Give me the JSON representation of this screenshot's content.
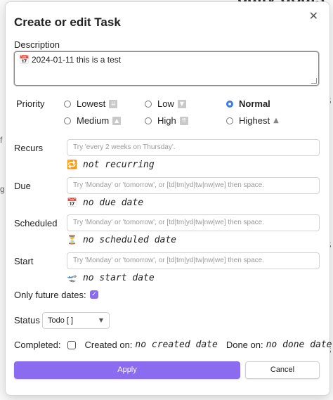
{
  "background": {
    "heading": "daily goals",
    "right_glyphs": [
      "S",
      "o",
      "S",
      "u",
      "s",
      "S"
    ],
    "left_glyphs": [
      "f",
      "g"
    ]
  },
  "modal": {
    "title": "Create or edit Task",
    "close_icon": "close-icon"
  },
  "description": {
    "label": "Description",
    "value": "2024-01-11 this is a test",
    "icon": "calendar-icon"
  },
  "priority": {
    "label": "Priority",
    "options": [
      {
        "label": "Lowest",
        "icon": "double-down-icon",
        "selected": false
      },
      {
        "label": "Low",
        "icon": "down-icon",
        "selected": false
      },
      {
        "label": "Normal",
        "icon": "",
        "selected": true
      },
      {
        "label": "Medium",
        "icon": "up-icon",
        "selected": false
      },
      {
        "label": "High",
        "icon": "double-up-icon",
        "selected": false
      },
      {
        "label": "Highest",
        "icon": "triangle-up-icon",
        "selected": false
      }
    ]
  },
  "recurs": {
    "label": "Recurs",
    "placeholder": "Try 'every 2 weeks on Thursday'.",
    "status": "not recurring",
    "status_icon": "repeat-icon"
  },
  "due": {
    "label": "Due",
    "placeholder": "Try 'Monday' or 'tomorrow', or [td|tm|yd|tw|nw|we] then space.",
    "status": "no due date",
    "status_icon": "calendar-icon"
  },
  "scheduled": {
    "label": "Scheduled",
    "placeholder": "Try 'Monday' or 'tomorrow', or [td|tm|yd|tw|nw|we] then space.",
    "status": "no scheduled date",
    "status_icon": "hourglass-icon"
  },
  "start": {
    "label": "Start",
    "placeholder": "Try 'Monday' or 'tomorrow', or [td|tm|yd|tw|nw|we] then space.",
    "status": "no start date",
    "status_icon": "plane-icon"
  },
  "future_dates": {
    "label": "Only future dates:",
    "checked": true
  },
  "status": {
    "label": "Status",
    "value": "Todo [ ]"
  },
  "completed": {
    "label": "Completed:",
    "checked": false,
    "created_label": "Created on:",
    "created_value": "no created date",
    "done_label": "Done on:",
    "done_value": "no done date"
  },
  "buttons": {
    "apply": "Apply",
    "cancel": "Cancel"
  },
  "colors": {
    "accent": "#8b6cf0",
    "radio_selected": "#3a7be0"
  }
}
